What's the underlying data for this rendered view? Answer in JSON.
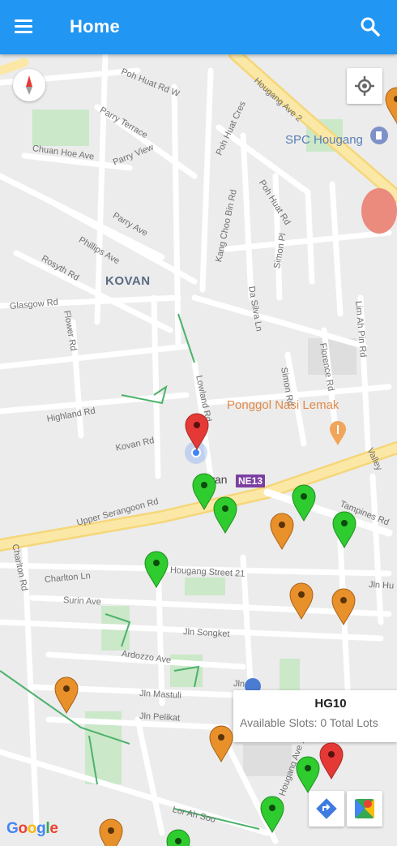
{
  "app_bar": {
    "title": "Home",
    "menu_icon": "hamburger-menu-icon",
    "search_icon": "search-icon",
    "color": "#2196f3"
  },
  "map": {
    "area_label": "KOVAN",
    "streets": [
      "Poh Huat Rd W",
      "Parry Terrace",
      "Chuan Hoe Ave",
      "Parry View",
      "Parry Ave",
      "Phillips Ave",
      "Rosyth Rd",
      "Glasgow Rd",
      "Flower Rd",
      "Highland Rd",
      "Kovan Rd",
      "Upper Serangoon Rd",
      "Hougang Ave 2",
      "Poh Huat Cres",
      "Poh Huat Rd",
      "Kang Choo Bin Rd",
      "Simon Pl",
      "Da Silva Ln",
      "Lowland Rd",
      "Simon Rd",
      "Florence Rd",
      "Lim Ah Pin Rd",
      "Valley",
      "Tampines Rd",
      "Hougang Street 21",
      "Charlton Rd",
      "Charlton Ln",
      "Surin Ave",
      "Jln Songket",
      "Jln Hu",
      "Jln Mastuli",
      "Jln Pelikat",
      "Lor Ah Soo",
      "Ardozzo Ave",
      "Hougang Ave 1",
      "Jln Ha"
    ],
    "pois": {
      "spc": "SPC Hougang",
      "food": "Ponggol Nasi Lemak",
      "station_code": "NE13",
      "station_partial": "van"
    },
    "attribution": "Google",
    "marker_colors": {
      "available": "#2ecc2e",
      "partial": "#e8902a",
      "selected": "#e53935"
    }
  },
  "info_window": {
    "title": "HG10",
    "text": "Available Slots: 0 Total Lots"
  },
  "controls": {
    "compass": "compass-icon",
    "my_location": "my-location-icon",
    "directions": "directions-icon",
    "open_maps": "google-maps-icon"
  }
}
